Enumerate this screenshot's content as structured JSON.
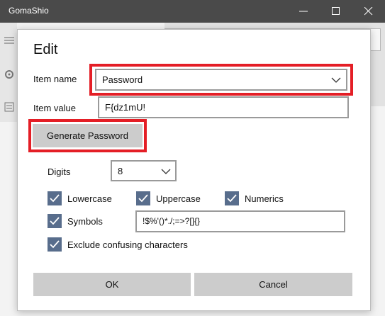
{
  "window": {
    "title": "GomaShio"
  },
  "dialog": {
    "heading": "Edit",
    "item_name": {
      "label": "Item name",
      "value": "Password"
    },
    "item_value": {
      "label": "Item value",
      "value": "F{dz1mU!"
    },
    "generate_label": "Generate Password",
    "digits": {
      "label": "Digits",
      "value": "8"
    },
    "options": {
      "lowercase": {
        "label": "Lowercase",
        "checked": true
      },
      "uppercase": {
        "label": "Uppercase",
        "checked": true
      },
      "numerics": {
        "label": "Numerics",
        "checked": true
      },
      "symbols": {
        "label": "Symbols",
        "checked": true,
        "value": "!$%'()*./;=>?[]{}"
      },
      "exclude_confusing": {
        "label": "Exclude confusing characters",
        "checked": true
      }
    },
    "ok_label": "OK",
    "cancel_label": "Cancel"
  },
  "colors": {
    "highlight": "#e41e26",
    "checkbox": "#586d8c",
    "titlebar": "#4a4a4a",
    "button": "#cccccc"
  }
}
